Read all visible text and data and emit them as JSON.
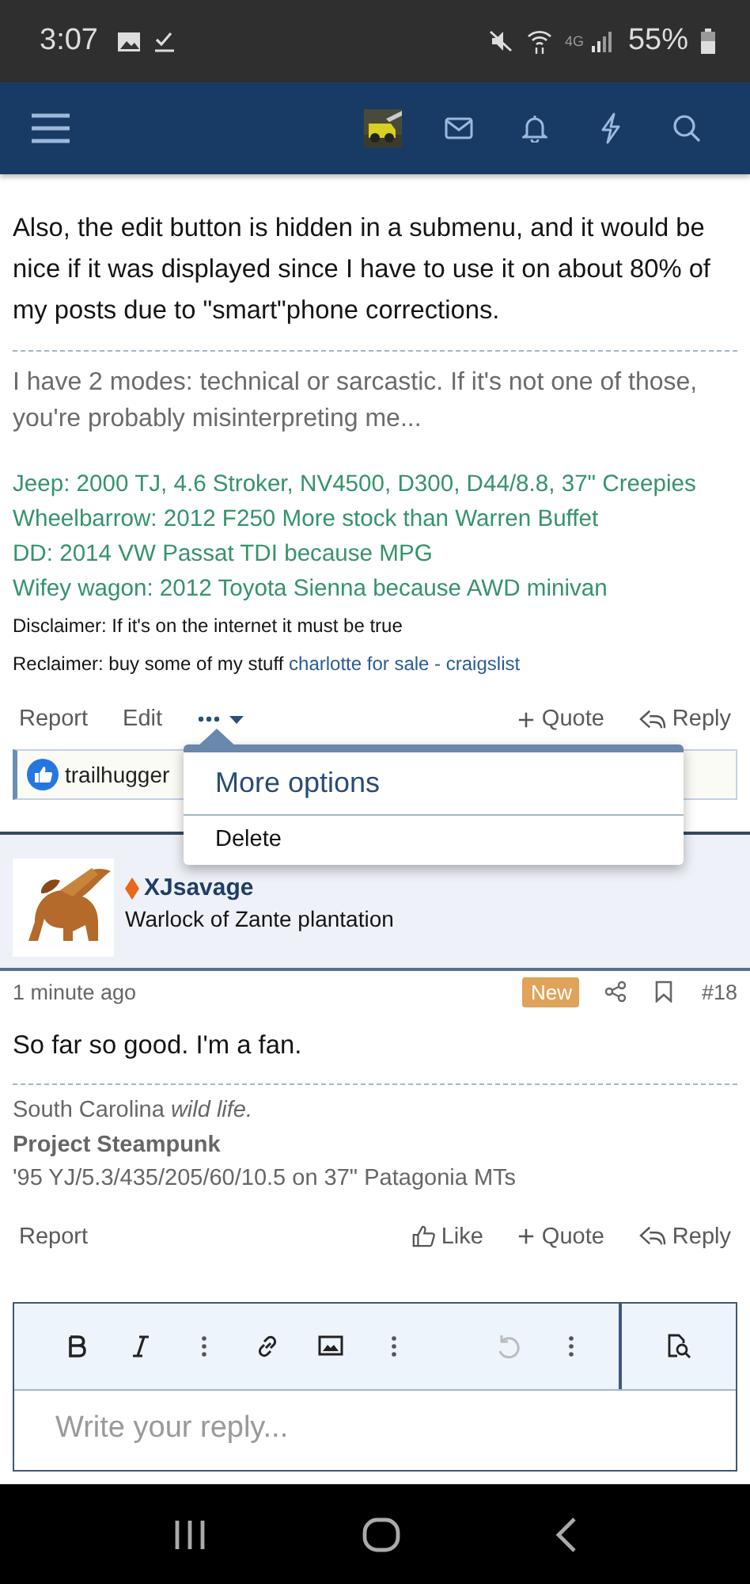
{
  "status_bar": {
    "time": "3:07",
    "network": "4G",
    "battery": "55%"
  },
  "post_1": {
    "body": "Also, the edit button is hidden in a submenu, and it would be nice if it was displayed since I have to use it on about 80% of my posts due to \"smart\"phone corrections.",
    "signature": {
      "note": "I have 2 modes: technical or sarcastic. If it's not one of those, you're probably misinterpreting me...",
      "vehicles": [
        "Jeep: 2000 TJ, 4.6 Stroker, NV4500, D300, D44/8.8, 37\" Creepies",
        "Wheelbarrow: 2012 F250 More stock than Warren Buffet",
        "DD: 2014 VW Passat TDI because MPG",
        "Wifey wagon: 2012 Toyota Sienna because AWD minivan"
      ],
      "disclaimer": "Disclaimer: If it's on the internet it must be true",
      "reclaimer": "Reclaimer: buy some of my stuff",
      "reclaimer_link": "charlotte for sale - craigslist"
    },
    "actions_left": [
      "Report",
      "Edit"
    ],
    "actions_right": [
      {
        "kind": "quote",
        "label": "Quote"
      },
      {
        "kind": "reply",
        "label": "Reply"
      }
    ],
    "reactions": "trailhugger"
  },
  "menu": {
    "title": "More options",
    "items": [
      "Delete"
    ]
  },
  "post_2": {
    "author": "XJsavage",
    "user_title": "Warlock of Zante plantation",
    "time": "1 minute ago",
    "badge": "New",
    "number": "#18",
    "body": "So far so good. I'm a fan.",
    "signature": [
      {
        "kind": "plain",
        "text": "South Carolina *wild life.*"
      },
      {
        "kind": "bold",
        "text": "Project Steampunk"
      },
      {
        "kind": "plain",
        "text": "'95 YJ/5.3/435/205/60/10.5 on 37\" Patagonia MTs"
      }
    ],
    "actions_left": [
      "Report"
    ],
    "actions_right": [
      {
        "kind": "like",
        "label": "Like"
      },
      {
        "kind": "quote",
        "label": "Quote"
      },
      {
        "kind": "reply",
        "label": "Reply"
      }
    ]
  },
  "editor": {
    "placeholder": "Write your reply..."
  }
}
